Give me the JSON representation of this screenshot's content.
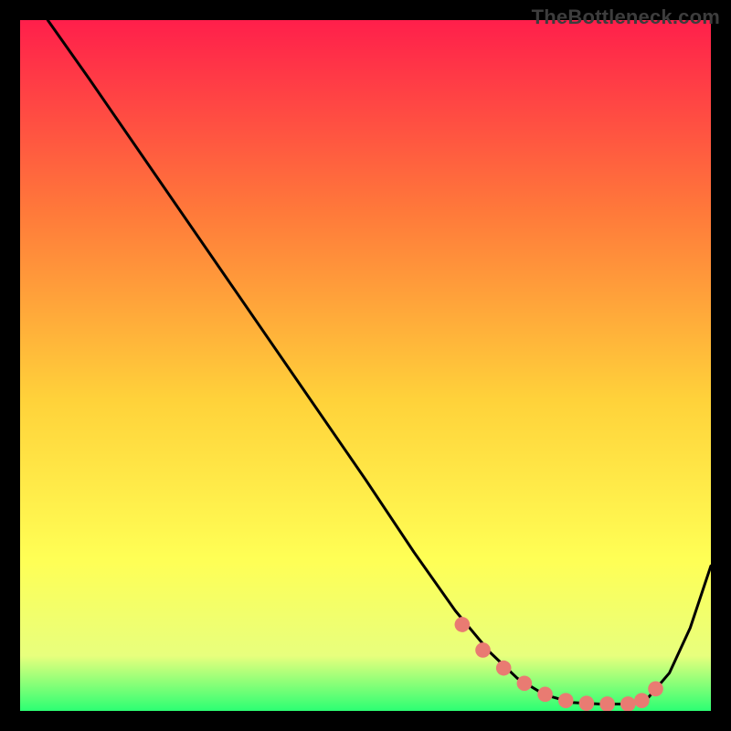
{
  "watermark": "TheBottleneck.com",
  "chart_data": {
    "type": "line",
    "title": "",
    "xlabel": "",
    "ylabel": "",
    "xlim": [
      0,
      100
    ],
    "ylim": [
      0,
      100
    ],
    "gradient_colors": {
      "top": "#ff1f4b",
      "upper_mid": "#ff7a3a",
      "mid": "#ffd23a",
      "lower_mid": "#ffff55",
      "lower": "#e8ff7d",
      "bottom": "#2cff73"
    },
    "curve": {
      "x": [
        4,
        10,
        20,
        30,
        40,
        50,
        57,
        63,
        68,
        72,
        76,
        80,
        84,
        88,
        91,
        94,
        97,
        100
      ],
      "y": [
        100,
        91.5,
        77,
        62.5,
        48,
        33.5,
        23,
        14.5,
        8.5,
        4.7,
        2.3,
        1.2,
        1,
        1,
        2,
        5.5,
        12,
        21
      ]
    },
    "marker_points": {
      "x": [
        64,
        67,
        70,
        73,
        76,
        79,
        82,
        85,
        88,
        90,
        92
      ],
      "y": [
        12.5,
        8.8,
        6.2,
        4,
        2.4,
        1.5,
        1.1,
        1,
        1,
        1.5,
        3.2
      ]
    },
    "marker_color": "#e97b72"
  }
}
